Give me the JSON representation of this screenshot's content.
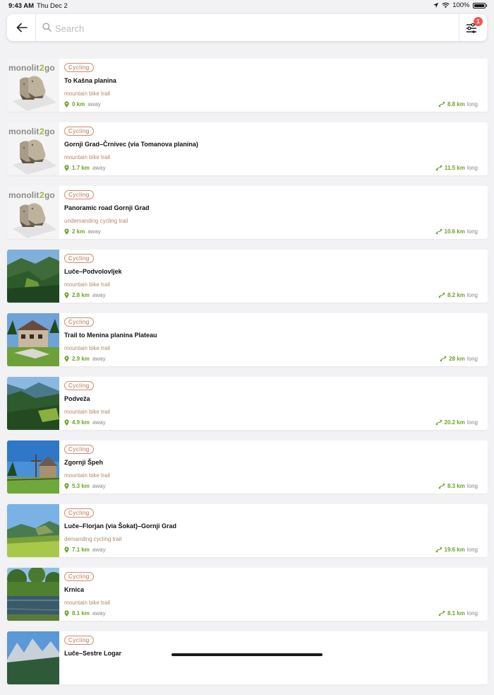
{
  "status": {
    "time": "9:43 AM",
    "date": "Thu Dec 2",
    "battery": "100%"
  },
  "search": {
    "placeholder": "Search",
    "filter_count": "1"
  },
  "unit_away": "away",
  "unit_long": "long",
  "items": [
    {
      "badge": "Cycling",
      "title": "To Kašna planina",
      "subtitle": "mountain bike trail",
      "distance": "0 km",
      "length": "8.8 km",
      "thumb": "monolit2go"
    },
    {
      "badge": "Cycling",
      "title": "Gornji Grad–Črnivec (via Tomanova planina)",
      "subtitle": "mountain bike trail",
      "distance": "1.7 km",
      "length": "11.5 km",
      "thumb": "monolit2go"
    },
    {
      "badge": "Cycling",
      "title": "Panoramic road Gornji Grad",
      "subtitle": "undemanding cycling trail",
      "distance": "2 km",
      "length": "10.6 km",
      "thumb": "monolit2go"
    },
    {
      "badge": "Cycling",
      "title": "Luče–Podvolovljek",
      "subtitle": "mountain bike trail",
      "distance": "2.8 km",
      "length": "8.2 km",
      "thumb": "valley"
    },
    {
      "badge": "Cycling",
      "title": "Trail to Menina planina Plateau",
      "subtitle": "mountain bike trail",
      "distance": "2.9 km",
      "length": "28 km",
      "thumb": "house"
    },
    {
      "badge": "Cycling",
      "title": "Podveža",
      "subtitle": "mountain bike trail",
      "distance": "4.9 km",
      "length": "20.2 km",
      "thumb": "valley2"
    },
    {
      "badge": "Cycling",
      "title": "Zgornji Špeh",
      "subtitle": "mountain bike trail",
      "distance": "5.3 km",
      "length": "8.3 km",
      "thumb": "chapel"
    },
    {
      "badge": "Cycling",
      "title": "Luče–Florjan (via Šokat)–Gornji Grad",
      "subtitle": "demanding cycling trail",
      "distance": "7.1 km",
      "length": "19.6 km",
      "thumb": "meadow"
    },
    {
      "badge": "Cycling",
      "title": "Krnica",
      "subtitle": "mountain bike trail",
      "distance": "8.1 km",
      "length": "8.1 km",
      "thumb": "lake"
    },
    {
      "badge": "Cycling",
      "title": "Luče–Sestre Logar",
      "subtitle": "",
      "distance": "",
      "length": "",
      "thumb": "mountains"
    }
  ],
  "colors": {
    "accent_green": "#6da22a",
    "badge_brown": "#b36b4a",
    "notification_red": "#ef5a4c"
  }
}
